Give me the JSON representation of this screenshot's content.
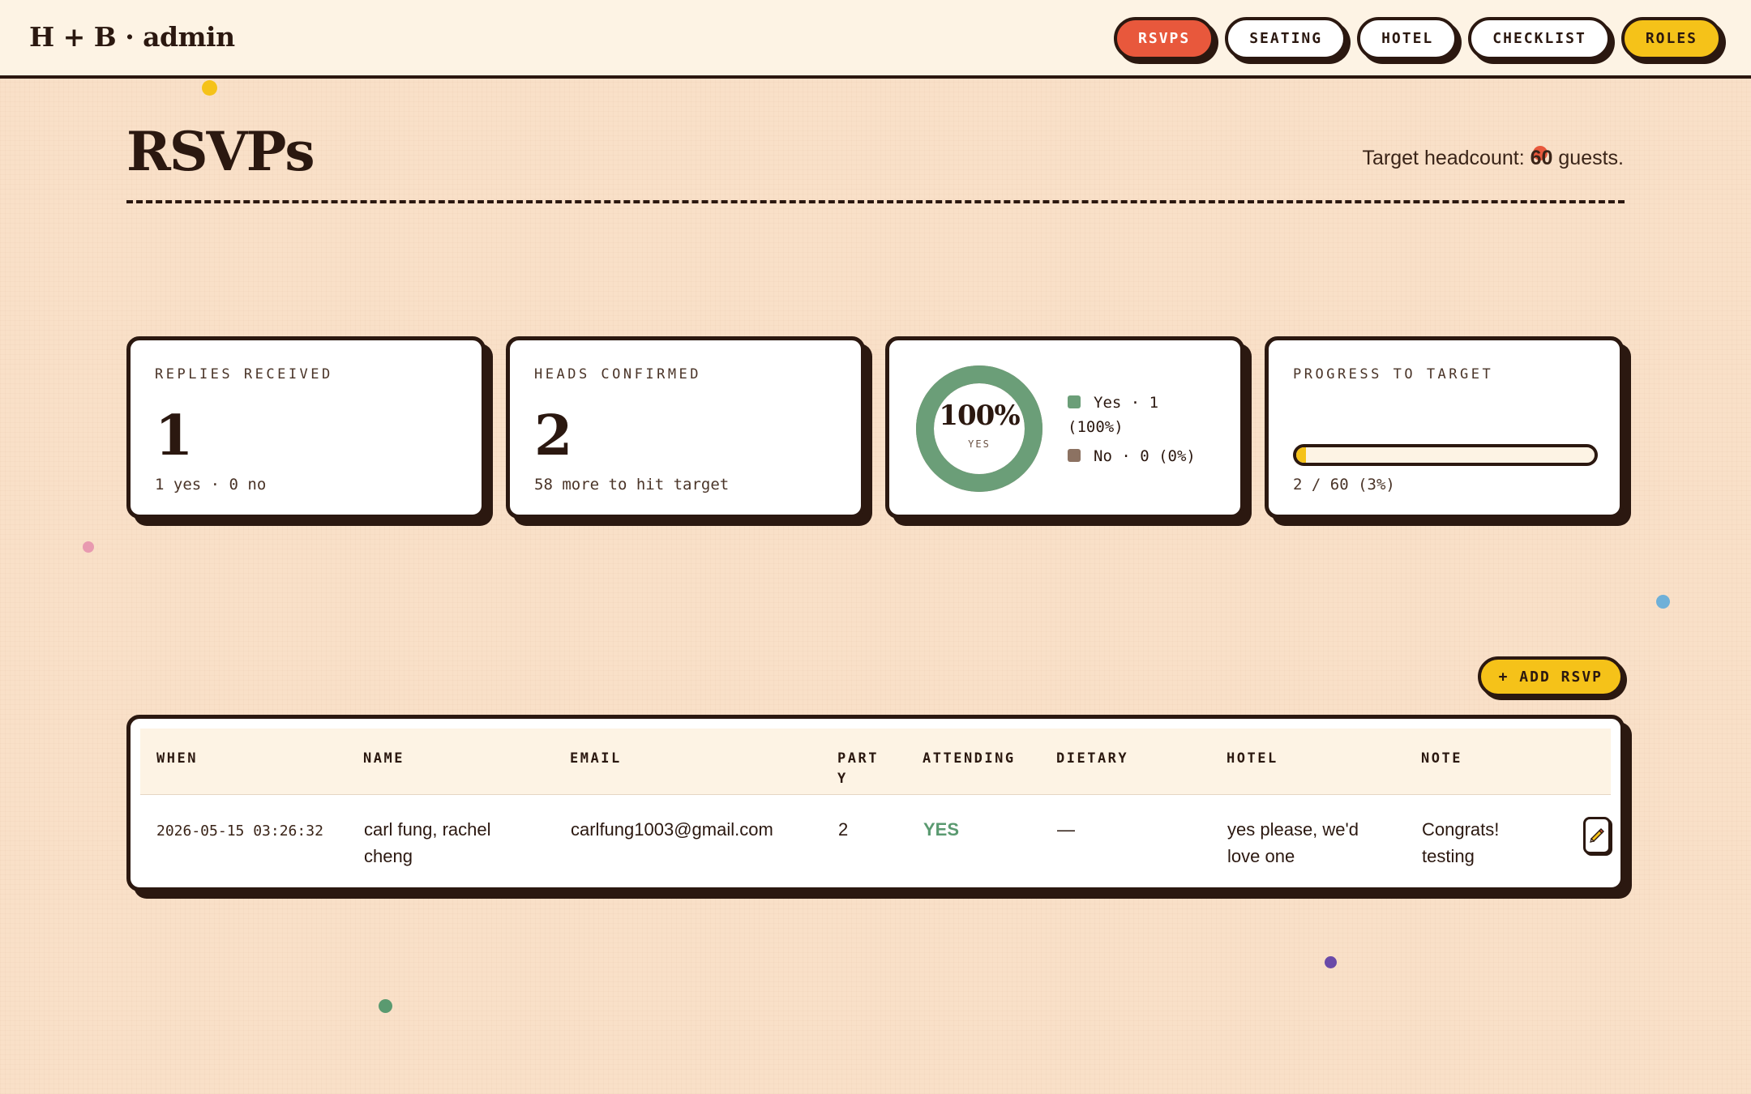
{
  "brand": "H + B · admin",
  "nav": {
    "rsvps": "RSVPS",
    "seating": "SEATING",
    "hotel": "HOTEL",
    "checklist": "CHECKLIST",
    "roles": "ROLES",
    "active": "RSVPS"
  },
  "page": {
    "title": "RSVPs",
    "target_prefix": "Target headcount:",
    "target_value": "60",
    "target_suffix": "guests."
  },
  "stats": {
    "replies": {
      "label": "REPLIES RECEIVED",
      "value": "1",
      "sub": "1 yes · 0 no"
    },
    "heads": {
      "label": "HEADS CONFIRMED",
      "value": "2",
      "sub": "58 more to hit target"
    },
    "donut": {
      "percent_label": "100%",
      "caption": "YES",
      "yes_fraction": 1.0,
      "legend_yes": "Yes · 1 (100%)",
      "legend_no": "No · 0 (0%)",
      "colors": {
        "yes": "#6b9e78",
        "no": "#8c7262"
      }
    },
    "progress": {
      "label": "PROGRESS TO TARGET",
      "sub": "2 / 60 (3%)",
      "fraction": 0.033
    }
  },
  "add_button": "+ ADD RSVP",
  "table": {
    "headers": {
      "when": "WHEN",
      "name": "NAME",
      "email": "EMAIL",
      "party": "PART Y",
      "attending": "ATTENDING",
      "dietary": "DIETARY",
      "hotel": "HOTEL",
      "note": "NOTE"
    },
    "row": {
      "when": "2026-05-15 03:26:32",
      "name": "carl fung, rachel cheng",
      "email": "carlfung1003@gmail.com",
      "party": "2",
      "attending": "YES",
      "dietary": "—",
      "hotel": "yes please, we'd love one",
      "note": "Congrats! testing",
      "edit_icon": "pencil-icon"
    }
  },
  "colors": {
    "ink": "#2b1810",
    "background": "#f9e0c8",
    "accent_red": "#e8583c",
    "accent_yellow": "#f5c219",
    "yes_green": "#6b9e78"
  }
}
